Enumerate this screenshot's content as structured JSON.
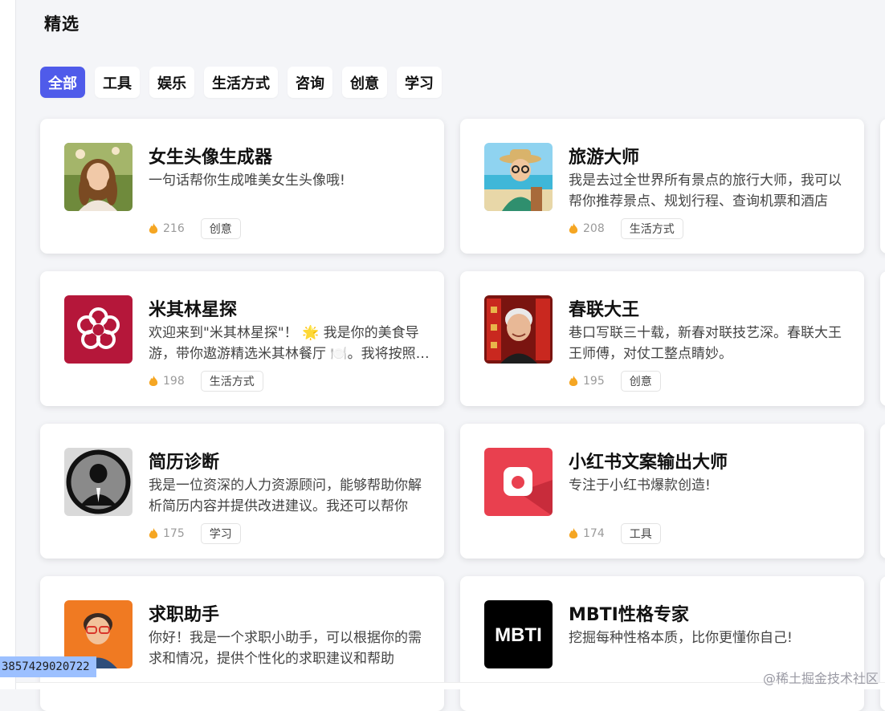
{
  "page": {
    "title": "精选"
  },
  "tabs": [
    {
      "label": "全部",
      "active": true
    },
    {
      "label": "工具"
    },
    {
      "label": "娱乐"
    },
    {
      "label": "生活方式"
    },
    {
      "label": "咨询"
    },
    {
      "label": "创意"
    },
    {
      "label": "学习"
    }
  ],
  "cards": [
    {
      "title": "女生头像生成器",
      "desc": "一句话帮你生成唯美女生头像哦!",
      "count": "216",
      "tag": "创意",
      "avatar": "girl-portrait"
    },
    {
      "title": "旅游大师",
      "desc": "我是去过全世界所有景点的旅行大师，我可以帮你推荐景点、规划行程、查询机票和酒店",
      "count": "208",
      "tag": "生活方式",
      "avatar": "traveler-avatar"
    },
    {
      "title": "米其林星探",
      "desc": "欢迎来到\"米其林星探\"！ 🌟 我是你的美食导游，带你遨游精选米其林餐厅 🍽️。我将按照你的需求推荐",
      "count": "198",
      "tag": "生活方式",
      "avatar": "michelin-logo"
    },
    {
      "title": "春联大王",
      "desc": "巷口写联三十载，新春对联技艺深。春联大王王师傅，对仗工整点睛妙。",
      "count": "195",
      "tag": "创意",
      "avatar": "calligrapher-portrait"
    },
    {
      "title": "简历诊断",
      "desc": "我是一位资深的人力资源顾问，能够帮助你解析简历内容并提供改进建议。我还可以帮你",
      "count": "175",
      "tag": "学习",
      "avatar": "hr-consultant-avatar"
    },
    {
      "title": "小红书文案输出大师",
      "desc": "专注于小红书爆款创造!",
      "count": "174",
      "tag": "工具",
      "avatar": "xiaohongshu-icon"
    },
    {
      "title": "求职助手",
      "desc": "你好！我是一个求职小助手，可以根据你的需求和情况，提供个性化的求职建议和帮助",
      "count": "",
      "tag": "",
      "avatar": "job-assistant-avatar"
    },
    {
      "title": "MBTI性格专家",
      "desc": "挖掘每种性格本质，比你更懂你自己!",
      "count": "",
      "tag": "",
      "avatar": "mbti-logo",
      "avatar_text": "MBTI"
    }
  ],
  "status_chip": "3857429020722",
  "watermark": "@稀土掘金技术社区",
  "colors": {
    "accent": "#4f5bea",
    "flame": "#f5a623",
    "background": "#f4f5f8"
  }
}
